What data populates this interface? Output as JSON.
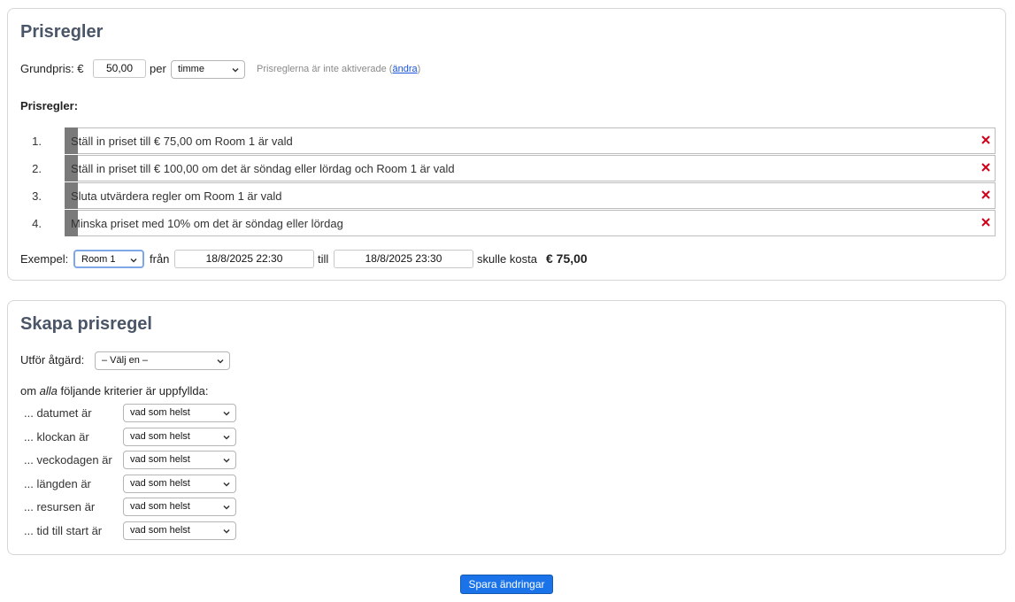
{
  "pricing": {
    "title": "Prisregler",
    "base_label": "Grundpris: €",
    "base_value": "50,00",
    "per_label": "per",
    "unit_selected": "timme",
    "status_text": "Prisreglerna är inte aktiverade (",
    "status_link": "ändra",
    "status_close": ")",
    "rules_heading": "Prisregler:",
    "rules": [
      {
        "num": "1.",
        "text": "Ställ in priset till € 75,00 om Room 1 är vald"
      },
      {
        "num": "2.",
        "text": "Ställ in priset till € 100,00 om det är söndag eller lördag och Room 1 är vald"
      },
      {
        "num": "3.",
        "text": "Sluta utvärdera regler om Room 1 är vald"
      },
      {
        "num": "4.",
        "text": "Minska priset med 10% om det är söndag eller lördag"
      }
    ],
    "example": {
      "label": "Exempel:",
      "resource_selected": "Room 1",
      "from_label": "från",
      "from_value": "18/8/2025 22:30",
      "to_label": "till",
      "to_value": "18/8/2025 23:30",
      "result_label": "skulle kosta",
      "result_value": "€ 75,00"
    }
  },
  "create": {
    "title": "Skapa prisregel",
    "action_label": "Utför åtgärd:",
    "action_selected": "– Välj en –",
    "criteria_prefix": "om ",
    "criteria_em": "alla",
    "criteria_suffix": " följande kriterier är uppfyllda:",
    "criteria": [
      {
        "label": "... datumet är",
        "selected": "vad som helst"
      },
      {
        "label": "... klockan är",
        "selected": "vad som helst"
      },
      {
        "label": "... veckodagen är",
        "selected": "vad som helst"
      },
      {
        "label": "... längden är",
        "selected": "vad som helst"
      },
      {
        "label": "... resursen är",
        "selected": "vad som helst"
      },
      {
        "label": "... tid till start är",
        "selected": "vad som helst"
      }
    ]
  },
  "save_label": "Spara ändringar",
  "colors": {
    "accent": "#1a73e8",
    "delete": "#d0021b",
    "rule_bar": "#7a7a7a"
  }
}
